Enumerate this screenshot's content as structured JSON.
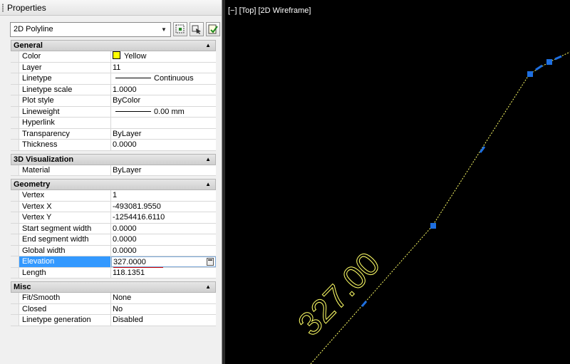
{
  "palette": {
    "title": "Properties",
    "object_type": "2D Polyline",
    "tools": [
      "quick-select-icon",
      "select-objects-icon",
      "toggle-pickadd-icon"
    ]
  },
  "sections": {
    "general": {
      "title": "General",
      "rows": [
        {
          "name": "Color",
          "value": "Yellow",
          "swatch": "#ffff00"
        },
        {
          "name": "Layer",
          "value": "11"
        },
        {
          "name": "Linetype",
          "value": "Continuous"
        },
        {
          "name": "Linetype scale",
          "value": "1.0000"
        },
        {
          "name": "Plot style",
          "value": "ByColor"
        },
        {
          "name": "Lineweight",
          "value": "0.00 mm"
        },
        {
          "name": "Hyperlink",
          "value": ""
        },
        {
          "name": "Transparency",
          "value": "ByLayer"
        },
        {
          "name": "Thickness",
          "value": "0.0000"
        }
      ]
    },
    "visualization": {
      "title": "3D Visualization",
      "rows": [
        {
          "name": "Material",
          "value": "ByLayer"
        }
      ]
    },
    "geometry": {
      "title": "Geometry",
      "rows": [
        {
          "name": "Vertex",
          "value": "1"
        },
        {
          "name": "Vertex X",
          "value": "-493081.9550"
        },
        {
          "name": "Vertex Y",
          "value": "-1254416.6110"
        },
        {
          "name": "Start segment width",
          "value": "0.0000"
        },
        {
          "name": "End segment width",
          "value": "0.0000"
        },
        {
          "name": "Global width",
          "value": "0.0000"
        },
        {
          "name": "Elevation",
          "value": "327.0000"
        },
        {
          "name": "Length",
          "value": "118.1351"
        }
      ]
    },
    "misc": {
      "title": "Misc",
      "rows": [
        {
          "name": "Fit/Smooth",
          "value": "None"
        },
        {
          "name": "Closed",
          "value": "No"
        },
        {
          "name": "Linetype generation",
          "value": "Disabled"
        }
      ]
    }
  },
  "viewport": {
    "label": "[−] [Top] [2D Wireframe]",
    "annotation": "327.00",
    "line_color": "#ffff66",
    "grip_color": "#1e6fe0"
  }
}
